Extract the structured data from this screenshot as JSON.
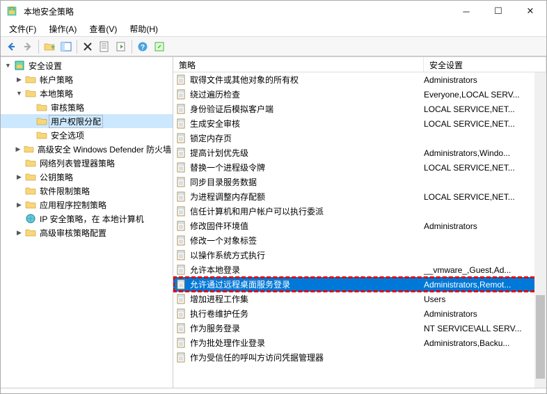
{
  "window": {
    "title": "本地安全策略"
  },
  "menu": {
    "file": "文件(F)",
    "action": "操作(A)",
    "view": "查看(V)",
    "help": "帮助(H)"
  },
  "tree": {
    "root": "安全设置",
    "accountPolicy": "帐户策略",
    "localPolicy": "本地策略",
    "auditPolicy": "审核策略",
    "userRights": "用户权限分配",
    "securityOptions": "安全选项",
    "advFirewall": "高级安全 Windows Defender 防火墙",
    "nlm": "网络列表管理器策略",
    "publicKey": "公钥策略",
    "software": "软件限制策略",
    "appControl": "应用程序控制策略",
    "ipsec": "IP 安全策略，在 本地计算机",
    "advAudit": "高级审核策略配置"
  },
  "listHeader": {
    "policy": "策略",
    "setting": "安全设置"
  },
  "rows": [
    {
      "policy": "取得文件或其他对象的所有权",
      "setting": "Administrators"
    },
    {
      "policy": "绕过遍历检查",
      "setting": "Everyone,LOCAL SERV..."
    },
    {
      "policy": "身份验证后模拟客户端",
      "setting": "LOCAL SERVICE,NET..."
    },
    {
      "policy": "生成安全审核",
      "setting": "LOCAL SERVICE,NET..."
    },
    {
      "policy": "锁定内存页",
      "setting": ""
    },
    {
      "policy": "提高计划优先级",
      "setting": "Administrators,Windo..."
    },
    {
      "policy": "替换一个进程级令牌",
      "setting": "LOCAL SERVICE,NET..."
    },
    {
      "policy": "同步目录服务数据",
      "setting": ""
    },
    {
      "policy": "为进程调整内存配额",
      "setting": "LOCAL SERVICE,NET..."
    },
    {
      "policy": "信任计算机和用户帐户可以执行委派",
      "setting": ""
    },
    {
      "policy": "修改固件环境值",
      "setting": "Administrators"
    },
    {
      "policy": "修改一个对象标签",
      "setting": ""
    },
    {
      "policy": "以操作系统方式执行",
      "setting": ""
    },
    {
      "policy": "允许本地登录",
      "setting": "__vmware_,Guest,Ad..."
    },
    {
      "policy": "允许通过远程桌面服务登录",
      "setting": "Administrators,Remot...",
      "selected": true,
      "framed": true
    },
    {
      "policy": "增加进程工作集",
      "setting": "Users"
    },
    {
      "policy": "执行卷维护任务",
      "setting": "Administrators"
    },
    {
      "policy": "作为服务登录",
      "setting": "NT SERVICE\\ALL SERV..."
    },
    {
      "policy": "作为批处理作业登录",
      "setting": "Administrators,Backu..."
    },
    {
      "policy": "作为受信任的呼叫方访问凭据管理器",
      "setting": ""
    }
  ]
}
